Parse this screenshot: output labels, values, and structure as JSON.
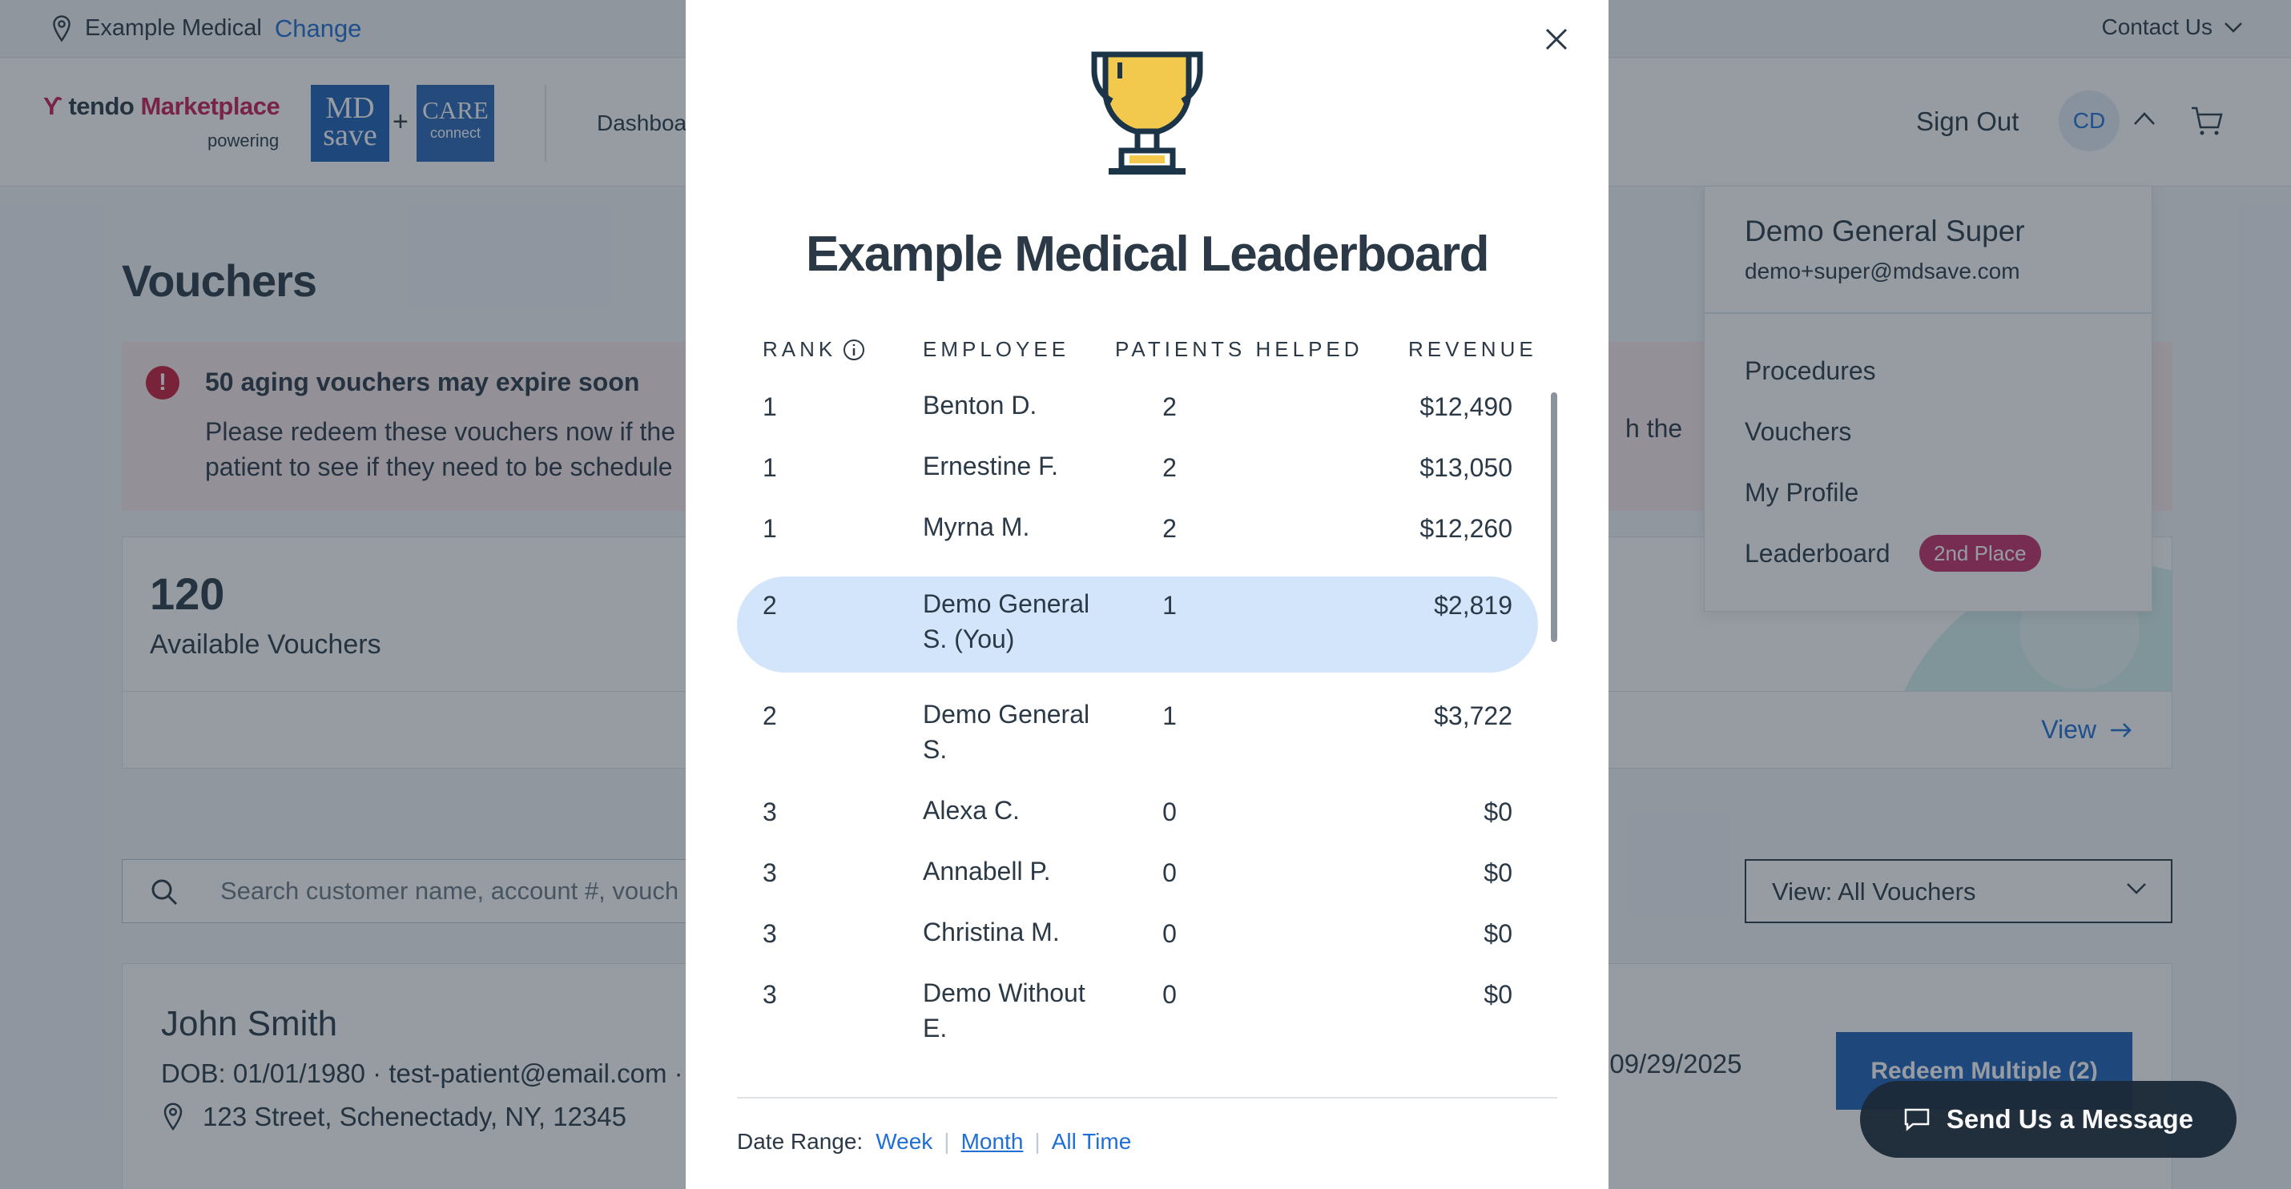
{
  "topbar": {
    "organization": "Example Medical",
    "change_label": "Change",
    "contact_label": "Contact Us"
  },
  "header": {
    "logo": {
      "tendo": "tendo",
      "marketplace": "Marketplace",
      "powering": "powering",
      "mdsave_line1": "MD",
      "mdsave_line2": "save",
      "plus": "+",
      "care_line1": "CARE",
      "care_line2": "connect"
    },
    "nav_partial": "Dashboa",
    "sign_out": "Sign Out",
    "avatar_initials": "CD"
  },
  "page": {
    "title": "Vouchers",
    "alert": {
      "title": "50 aging vouchers may expire soon",
      "body_line1": "Please redeem these vouchers now if the",
      "body_line1_tail": "h the",
      "body_line2": "patient to see if they need to be schedule"
    },
    "stats": {
      "count": "120",
      "label": "Available Vouchers",
      "view_label": "View"
    },
    "search_placeholder": "Search customer name, account #, vouch",
    "view_select": "View: All Vouchers",
    "patient": {
      "name": "John Smith",
      "dob_line": "DOB: 01/01/1980 · test-patient@email.com ·",
      "address": "123 Street, Schenectady, NY, 12345",
      "expiry_partial": ": 09/29/2025"
    },
    "redeem_button": "Redeem Multiple (2)",
    "chat_button": "Send Us a Message"
  },
  "profile_menu": {
    "name": "Demo General Super",
    "email": "demo+super@mdsave.com",
    "items": [
      "Procedures",
      "Vouchers",
      "My Profile",
      "Leaderboard"
    ],
    "leaderboard_badge": "2nd Place"
  },
  "modal": {
    "title": "Example Medical Leaderboard",
    "columns": {
      "rank": "RANK",
      "employee": "EMPLOYEE",
      "patients": "PATIENTS HELPED",
      "revenue": "REVENUE"
    },
    "rows": [
      {
        "rank": "1",
        "employee": "Benton D.",
        "patients": "2",
        "revenue": "$12,490"
      },
      {
        "rank": "1",
        "employee": "Ernestine F.",
        "patients": "2",
        "revenue": "$13,050"
      },
      {
        "rank": "1",
        "employee": "Myrna M.",
        "patients": "2",
        "revenue": "$12,260"
      },
      {
        "rank": "2",
        "employee": "Demo General S. (You)",
        "patients": "1",
        "revenue": "$2,819",
        "is_you": true
      },
      {
        "rank": "2",
        "employee": "Demo General S.",
        "patients": "1",
        "revenue": "$3,722"
      },
      {
        "rank": "3",
        "employee": "Alexa C.",
        "patients": "0",
        "revenue": "$0"
      },
      {
        "rank": "3",
        "employee": "Annabell P.",
        "patients": "0",
        "revenue": "$0"
      },
      {
        "rank": "3",
        "employee": "Christina M.",
        "patients": "0",
        "revenue": "$0"
      },
      {
        "rank": "3",
        "employee": "Demo Without E.",
        "patients": "0",
        "revenue": "$0"
      }
    ],
    "date_range": {
      "label": "Date Range:",
      "options": [
        "Week",
        "Month",
        "All Time"
      ],
      "selected": "Month"
    }
  },
  "colors": {
    "accent": "#1f6fd6",
    "highlight_row": "#d2e5fb",
    "badge": "#c42d67",
    "trophy_gold": "#f2c94c",
    "brand_blue": "#1e5fb6"
  }
}
